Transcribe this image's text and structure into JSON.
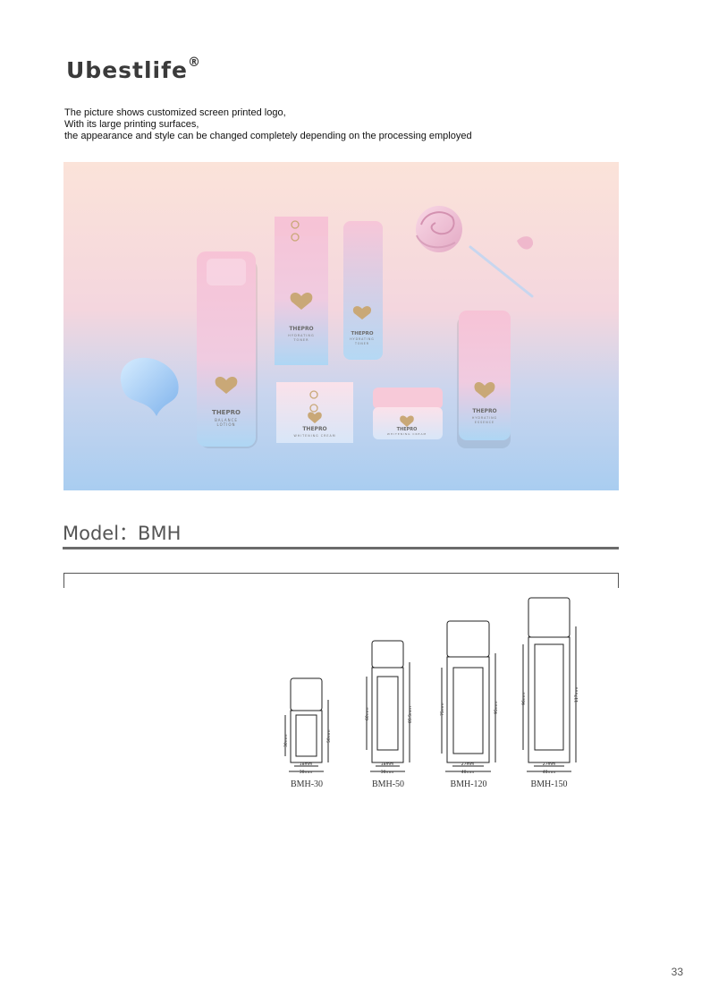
{
  "brand": {
    "name": "Ubestlife",
    "mark": "®"
  },
  "intro": {
    "lines": [
      "The picture shows customized screen printed logo,",
      "With its large printing surfaces,",
      "the appearance and style can be changed completely depending on the processing employed"
    ]
  },
  "hero": {
    "products": {
      "tall_bottle": {
        "brand": "THEPRO",
        "line1": "BALANCE",
        "line2": "LOTION"
      },
      "box_top": {
        "brand": "THEPRO",
        "line1": "HYDRATING",
        "line2": "TONER"
      },
      "bottle_mid": {
        "brand": "THEPRO",
        "line1": "HYDRATING",
        "line2": "TONER"
      },
      "box_bottom": {
        "brand": "THEPRO",
        "line1": "WHITENING CREAM"
      },
      "jar": {
        "brand": "THEPRO",
        "line1": "WHITENING CREAM"
      },
      "right_bottle": {
        "brand": "THEPRO",
        "line1": "HYDRATING",
        "line2": "ESSENCE"
      }
    },
    "colors": {
      "pink": "#f6c9d8",
      "blue": "#a9d3f3",
      "gold": "#c9a877"
    }
  },
  "model": {
    "label": "Model：BMH"
  },
  "specs": [
    {
      "name": "BMH-30",
      "height": "50mm",
      "label_h": "30mm",
      "inner_w": "18mm",
      "outer_w": "30mm"
    },
    {
      "name": "BMH-50",
      "height": "85.5mm",
      "label_h": "60mm",
      "inner_w": "18mm",
      "outer_w": "30mm"
    },
    {
      "name": "BMH-120",
      "height": "95mm",
      "label_h": "75mm",
      "inner_w": "27mm",
      "outer_w": "40mm"
    },
    {
      "name": "BMH-150",
      "height": "117mm",
      "label_h": "96mm",
      "inner_w": "27mm",
      "outer_w": "40mm"
    }
  ],
  "page": {
    "number": "33"
  }
}
